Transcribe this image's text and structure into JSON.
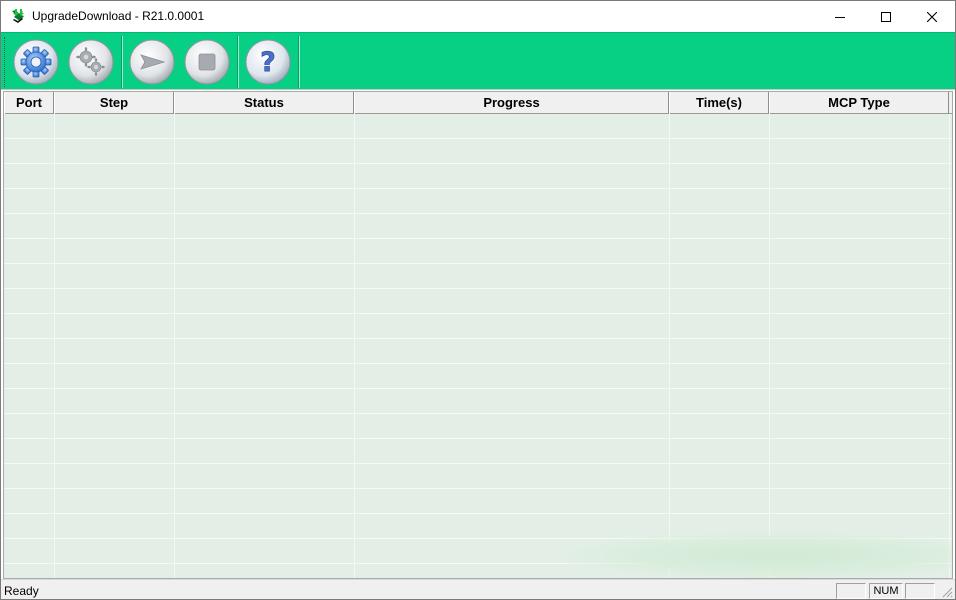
{
  "window": {
    "title": "UpgradeDownload - R21.0.0001"
  },
  "title_buttons": {
    "minimize_icon": "minimize-icon",
    "maximize_icon": "maximize-icon",
    "close_icon": "close-icon"
  },
  "toolbar": {
    "background": "#07d084",
    "buttons": [
      {
        "id": "settings",
        "icon": "gear-icon",
        "state": "enabled"
      },
      {
        "id": "advanced-settings",
        "icon": "gears-icon",
        "state": "disabled"
      },
      {
        "id": "start",
        "icon": "play-arrow-icon",
        "state": "disabled"
      },
      {
        "id": "stop",
        "icon": "stop-square-icon",
        "state": "disabled"
      },
      {
        "id": "help",
        "icon": "question-mark-icon",
        "state": "enabled"
      }
    ]
  },
  "list": {
    "columns": [
      "Port",
      "Step",
      "Status",
      "Progress",
      "Time(s)",
      "MCP Type"
    ],
    "rows": []
  },
  "statusbar": {
    "text": "Ready",
    "panes": [
      "",
      "NUM",
      ""
    ]
  }
}
